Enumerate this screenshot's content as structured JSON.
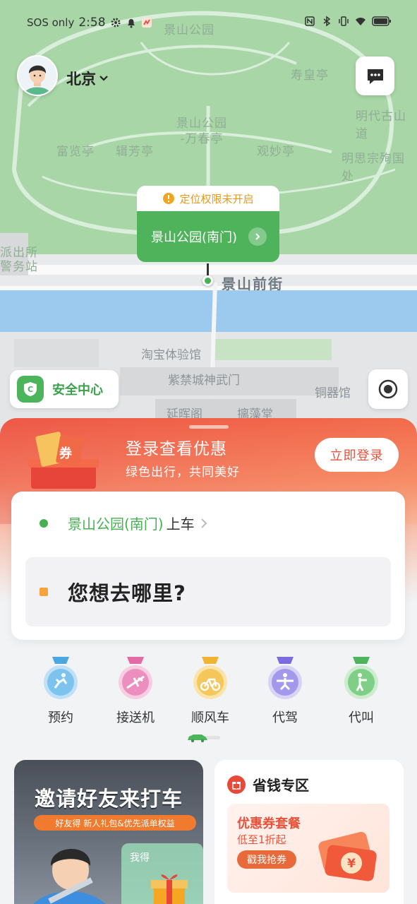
{
  "status_bar": {
    "carrier": "SOS only",
    "time": "2:58",
    "icons": [
      "settings-icon",
      "bell-icon",
      "activity-icon",
      "nfc-icon",
      "bluetooth-icon",
      "vibrate-icon",
      "wifi-icon",
      "battery-icon"
    ]
  },
  "header": {
    "city": "北京",
    "avatar": "user-avatar",
    "message_icon": "message-icon"
  },
  "map": {
    "labels": [
      "景山公园",
      "寿皇亭",
      "明代古山道",
      "富览亭",
      "辑芳亭",
      "景山公园\n-万春亭",
      "观妙亭",
      "明思宗殉国处",
      "派出所\n警务站",
      "景山前街",
      "淘宝体验馆",
      "紫禁城神武门",
      "铜器馆",
      "延晖阁",
      "摛藻堂"
    ],
    "location_warning": "定位权限未开启",
    "pickup_place": "景山公园(南门)"
  },
  "safety_center": {
    "label": "安全中心",
    "icon": "shield-icon"
  },
  "promo": {
    "title": "登录查看优惠",
    "subtitle": "绿色出行，共同美好",
    "coupon_text": "券",
    "login_button": "立即登录"
  },
  "trip": {
    "pickup_place": "景山公园(南门)",
    "pickup_suffix": "上车",
    "destination_placeholder": "您想去哪里?"
  },
  "services": [
    {
      "label": "预约",
      "icon": "runner-medal-icon",
      "color": "#4aa7e0"
    },
    {
      "label": "接送机",
      "icon": "airplane-medal-icon",
      "color": "#e36aa5"
    },
    {
      "label": "顺风车",
      "icon": "bicycle-medal-icon",
      "color": "#f0b432"
    },
    {
      "label": "代驾",
      "icon": "skater-medal-icon",
      "color": "#7a6be0"
    },
    {
      "label": "代叫",
      "icon": "walker-medal-icon",
      "color": "#4cb45a"
    }
  ],
  "invite_card": {
    "title": "邀请好友来打车",
    "subtitle": "好友得 新人礼包&优先派单权益",
    "gift_label": "我得"
  },
  "save_card": {
    "title": "省钱专区",
    "coupon_title": "优惠券套餐",
    "coupon_sub": "低至1折起",
    "coupon_button": "戳我抢券",
    "coupon_symbol": "¥"
  }
}
